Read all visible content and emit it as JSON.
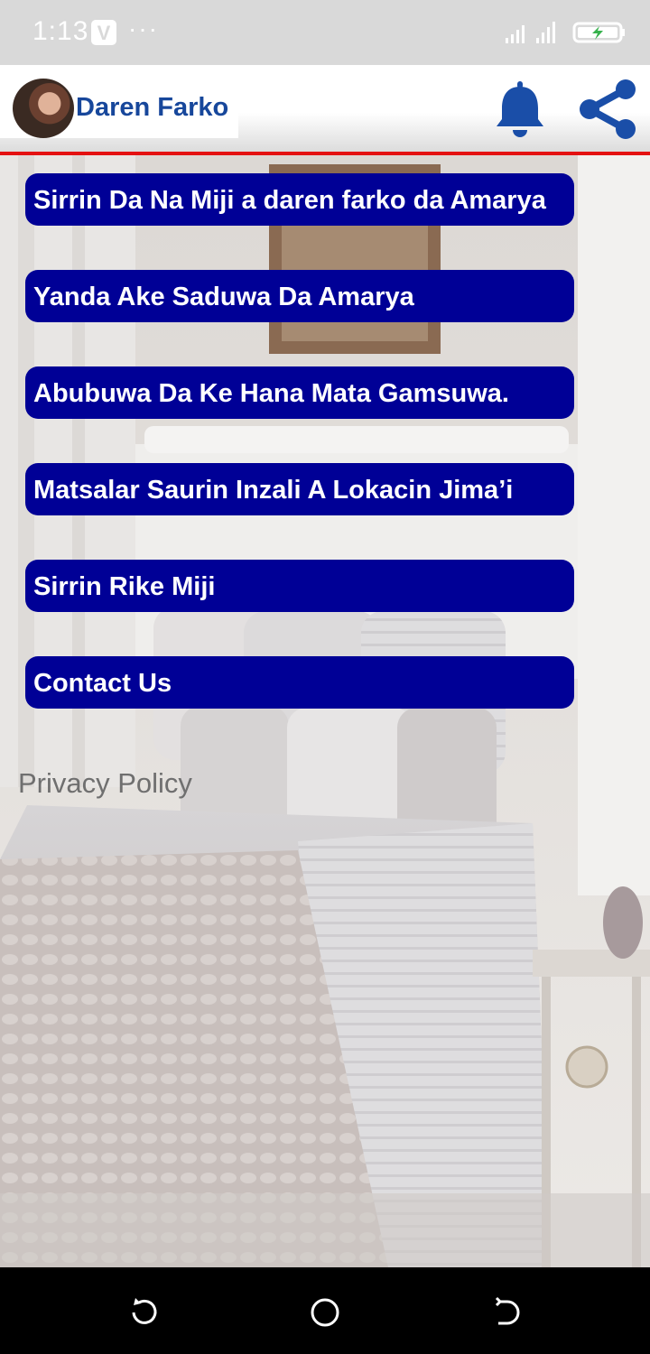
{
  "status_bar": {
    "time": "1:13",
    "app_badge": "V",
    "more": "···"
  },
  "app_bar": {
    "title": "Daren Farko"
  },
  "menu": [
    {
      "label": "Sirrin Da Na Miji a daren farko da Amarya"
    },
    {
      "label": "Yanda Ake Saduwa Da Amarya"
    },
    {
      "label": "Abubuwa Da Ke Hana Mata Gamsuwa."
    },
    {
      "label": "Matsalar Saurin Inzali A Lokacin Jima’i"
    },
    {
      "label": "Sirrin Rike Miji"
    },
    {
      "label": "Contact Us"
    }
  ],
  "privacy_policy": "Privacy Policy",
  "colors": {
    "button_bg": "#000096",
    "title_blue": "#17479b",
    "accent_red": "#e41111",
    "icon_blue": "#1a4ea8"
  },
  "icons": [
    "bell-icon",
    "share-icon",
    "back-icon",
    "home-icon",
    "recents-icon"
  ]
}
